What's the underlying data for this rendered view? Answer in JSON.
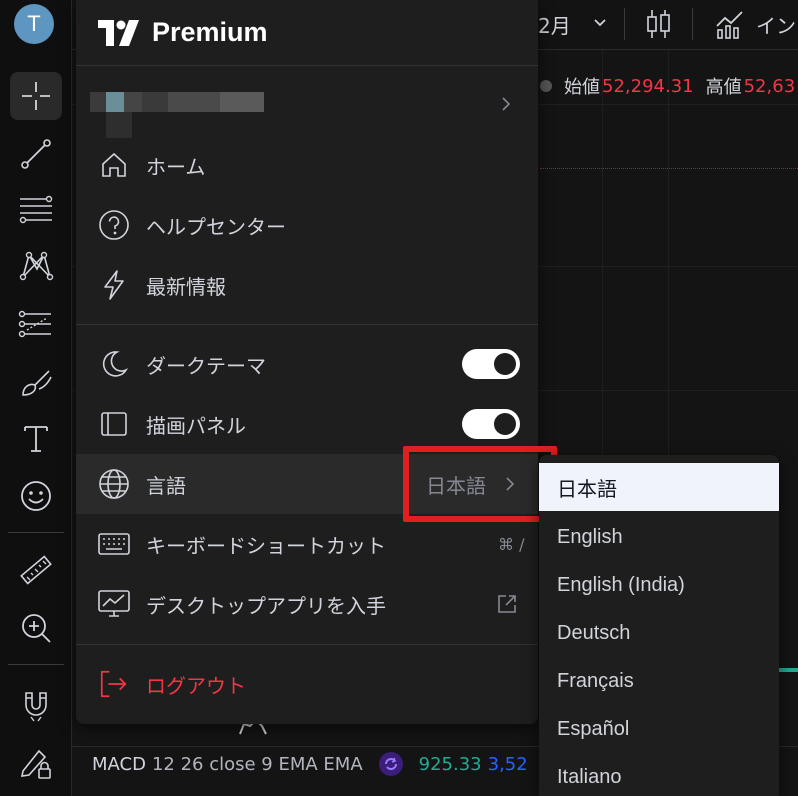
{
  "toolbar": {
    "avatar_letter": "T",
    "tools": [
      "crosshair-icon",
      "trend-line-icon",
      "fib-lines-icon",
      "pattern-icon",
      "prediction-icon",
      "brush-icon",
      "text-icon",
      "emoji-icon",
      "ruler-icon",
      "zoom-in-icon",
      "magnet-icon",
      "lock-drawings-icon"
    ]
  },
  "topbar": {
    "period": "2月",
    "indicators_label": "イン"
  },
  "ohlc": {
    "open_label": "始値",
    "open_value": "52,294.31",
    "high_label": "高値",
    "high_value": "52,63"
  },
  "macd": {
    "name": "MACD",
    "params": "12 26 close 9 EMA EMA",
    "value1": "925.33",
    "value2": "3,52"
  },
  "menu": {
    "brand": "Premium",
    "items": {
      "home": "ホーム",
      "help": "ヘルプセンター",
      "whats_new": "最新情報",
      "dark_theme": "ダークテーマ",
      "drawing_panel": "描画パネル",
      "language": "言語",
      "language_value": "日本語",
      "shortcuts": "キーボードショートカット",
      "shortcuts_key": "⌘ /",
      "desktop_app": "デスクトップアプリを入手",
      "logout": "ログアウト"
    },
    "toggles": {
      "dark_theme": true,
      "drawing_panel": true
    }
  },
  "languages": {
    "selected": "日本語",
    "options": [
      "日本語",
      "English",
      "English (India)",
      "Deutsch",
      "Français",
      "Español",
      "Italiano"
    ]
  },
  "colors": {
    "accent_red": "#f23645",
    "highlight_box": "#e02020",
    "avatar": "#5d96c1"
  }
}
